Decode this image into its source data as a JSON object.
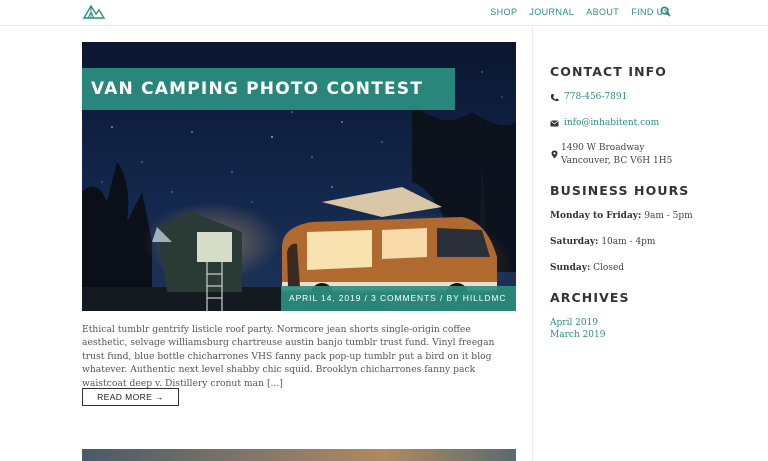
{
  "header": {
    "logo": "mountain-tent-logo",
    "nav": [
      "SHOP",
      "JOURNAL",
      "ABOUT",
      "FIND US"
    ]
  },
  "post": {
    "title": "VAN CAMPING PHOTO CONTEST",
    "meta": "APRIL 14, 2019 / 3 COMMENTS / BY HILLDMC",
    "excerpt": "Ethical tumblr gentrify listicle roof party. Normcore jean shorts single-origin coffee aesthetic, selvage williamsburg chartreuse austin banjo tumblr trust fund. Vinyl freegan trust fund, blue bottle chicharrones VHS fanny pack pop-up tumblr put a bird on it blog whatever. Authentic next level shabby chic squid. Brooklyn chicharrones fanny pack waistcoat deep v. Distillery cronut man [...]",
    "read_more": "READ MORE →"
  },
  "sidebar": {
    "contact_heading": "CONTACT INFO",
    "phone": "778-456-7891",
    "email": "info@inhabitent.com",
    "address_line1": "1490 W Broadway",
    "address_line2": "Vancouver, BC V6H 1H5",
    "hours_heading": "BUSINESS HOURS",
    "hours": [
      {
        "label": "Monday to Friday:",
        "value": "9am - 5pm"
      },
      {
        "label": "Saturday:",
        "value": "10am - 4pm"
      },
      {
        "label": "Sunday:",
        "value": "Closed"
      }
    ],
    "archives_heading": "ARCHIVES",
    "archives": [
      "April 2019",
      "March 2019"
    ]
  },
  "colors": {
    "accent": "#2a8f80",
    "text": "#333333"
  }
}
